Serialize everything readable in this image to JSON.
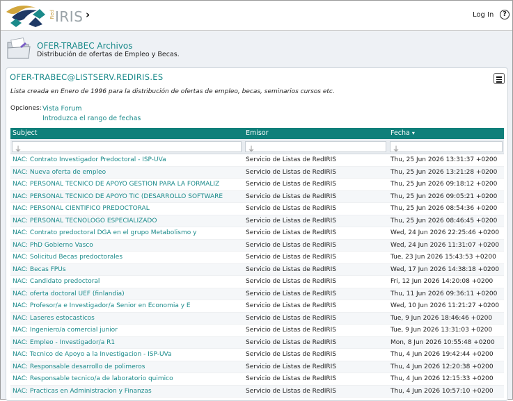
{
  "header": {
    "logo_word": "IRIS",
    "logo_small": "Red",
    "login_label": "Log In",
    "help_glyph": "?"
  },
  "list": {
    "title": "OFER-TRABEC Archivos",
    "description": "Distribución de ofertas de Empleo y Becas."
  },
  "panel": {
    "email": "OFER-TRABEC@LISTSERV.REDIRIS.ES",
    "note": "Lista creada en Enero de 1996 para la distribución de ofertas de empleo, becas, seminarios cursos etc.",
    "options_label": "Opciones:",
    "options": [
      "Vista Forum",
      "Introduzca el rango de fechas"
    ]
  },
  "table": {
    "columns": [
      "Subject",
      "Emisor",
      "Fecha"
    ],
    "sort_indicator": "▾",
    "rows": [
      {
        "subject": "NAC: Contrato Investigador Predoctoral - ISP-UVa",
        "sender": "Servicio de Listas de RedIRIS",
        "date": "Thu, 25 Jun 2026 13:31:37 +0200"
      },
      {
        "subject": "NAC: Nueva oferta de empleo",
        "sender": "Servicio de Listas de RedIRIS",
        "date": "Thu, 25 Jun 2026 13:21:28 +0200"
      },
      {
        "subject": "NAC: PERSONAL TECNICO DE APOYO GESTION PARA LA FORMALIZ",
        "sender": "Servicio de Listas de RedIRIS",
        "date": "Thu, 25 Jun 2026 09:18:12 +0200"
      },
      {
        "subject": "NAC: PERSONAL TECNICO DE APOYO TIC (DESARROLLO SOFTWARE",
        "sender": "Servicio de Listas de RedIRIS",
        "date": "Thu, 25 Jun 2026 09:05:21 +0200"
      },
      {
        "subject": "NAC: PERSONAL CIENTIFICO PREDOCTORAL",
        "sender": "Servicio de Listas de RedIRIS",
        "date": "Thu, 25 Jun 2026 08:54:36 +0200"
      },
      {
        "subject": "NAC: PERSONAL TECNOLOGO ESPECIALIZADO",
        "sender": "Servicio de Listas de RedIRIS",
        "date": "Thu, 25 Jun 2026 08:46:45 +0200"
      },
      {
        "subject": "NAC: Contrato predoctoral DGA en el grupo Metabolismo y",
        "sender": "Servicio de Listas de RedIRIS",
        "date": "Wed, 24 Jun 2026 22:25:46 +0200"
      },
      {
        "subject": "NAC: PhD Gobierno Vasco",
        "sender": "Servicio de Listas de RedIRIS",
        "date": "Wed, 24 Jun 2026 11:31:07 +0200"
      },
      {
        "subject": "NAC: Solicitud Becas predoctorales",
        "sender": "Servicio de Listas de RedIRIS",
        "date": "Tue, 23 Jun 2026 15:43:53 +0200"
      },
      {
        "subject": "NAC: Becas FPUs",
        "sender": "Servicio de Listas de RedIRIS",
        "date": "Wed, 17 Jun 2026 14:38:18 +0200"
      },
      {
        "subject": "NAC: Candidato predoctoral",
        "sender": "Servicio de Listas de RedIRIS",
        "date": "Fri, 12 Jun 2026 14:20:08 +0200"
      },
      {
        "subject": "NAC: oferta doctoral UEF (finlandia)",
        "sender": "Servicio de Listas de RedIRIS",
        "date": "Thu, 11 Jun 2026 09:36:11 +0200"
      },
      {
        "subject": "NAC: Profesor/a e Investigador/a Senior en Economia y E",
        "sender": "Servicio de Listas de RedIRIS",
        "date": "Wed, 10 Jun 2026 11:21:27 +0200"
      },
      {
        "subject": "NAC: Laseres estocasticos",
        "sender": "Servicio de Listas de RedIRIS",
        "date": "Tue, 9 Jun 2026 18:46:46 +0200"
      },
      {
        "subject": "NAC: Ingeniero/a comercial junior",
        "sender": "Servicio de Listas de RedIRIS",
        "date": "Tue, 9 Jun 2026 13:31:03 +0200"
      },
      {
        "subject": "NAC: Empleo - Investigador/a R1",
        "sender": "Servicio de Listas de RedIRIS",
        "date": "Mon, 8 Jun 2026 10:55:48 +0200"
      },
      {
        "subject": "NAC: Tecnico de Apoyo a la Investigacion - ISP-UVa",
        "sender": "Servicio de Listas de RedIRIS",
        "date": "Thu, 4 Jun 2026 19:42:44 +0200"
      },
      {
        "subject": "NAC: Responsable desarrollo de polimeros",
        "sender": "Servicio de Listas de RedIRIS",
        "date": "Thu, 4 Jun 2026 12:20:38 +0200"
      },
      {
        "subject": "NAC: Responsable tecnico/a de laboratorio quimico",
        "sender": "Servicio de Listas de RedIRIS",
        "date": "Thu, 4 Jun 2026 12:15:33 +0200"
      },
      {
        "subject": "NAC: Practicas en Administracion y Finanzas",
        "sender": "Servicio de Listas de RedIRIS",
        "date": "Thu, 4 Jun 2026 10:57:10 +0200"
      }
    ]
  },
  "colors": {
    "accent": "#1a8a8a",
    "table_header": "#0f7f7a",
    "logo_navy": "#1f3a66",
    "logo_gold": "#d2a63c"
  }
}
